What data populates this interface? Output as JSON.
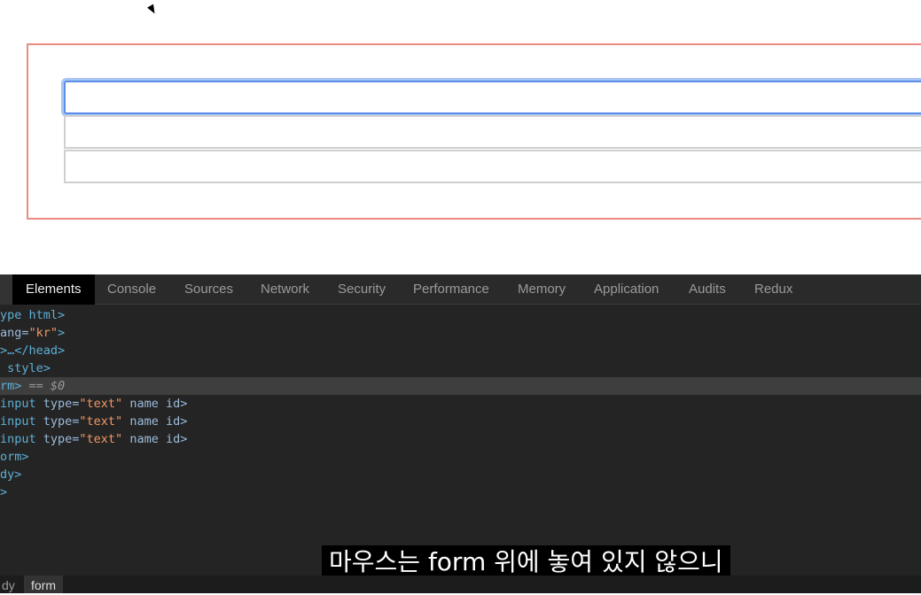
{
  "devtools": {
    "tabs": [
      {
        "label": "Elements"
      },
      {
        "label": "Console"
      },
      {
        "label": "Sources"
      },
      {
        "label": "Network"
      },
      {
        "label": "Security"
      },
      {
        "label": "Performance"
      },
      {
        "label": "Memory"
      },
      {
        "label": "Application"
      },
      {
        "label": "Audits"
      },
      {
        "label": "Redux"
      }
    ],
    "dom_lines": [
      {
        "text": "ype html>"
      },
      {
        "tag_open": "ang=",
        "val": "\"kr\"",
        "tag_close": ">"
      },
      {
        "text": ">…</head>"
      },
      {
        "text": " style>"
      },
      {
        "tag": "rm>",
        "suffix": " == $0"
      },
      {
        "tag": "input ",
        "attr": "type=",
        "val": "\"text\"",
        "rest": " name id>"
      },
      {
        "tag": "input ",
        "attr": "type=",
        "val": "\"text\"",
        "rest": " name id>"
      },
      {
        "tag": "input ",
        "attr": "type=",
        "val": "\"text\"",
        "rest": " name id>"
      },
      {
        "text": "orm>"
      },
      {
        "text": "dy>"
      },
      {
        "text": ">"
      }
    ],
    "breadcrumbs": [
      "dy",
      "form"
    ]
  },
  "subtitle": "마우스는 form 위에 놓여 있지 않으니"
}
